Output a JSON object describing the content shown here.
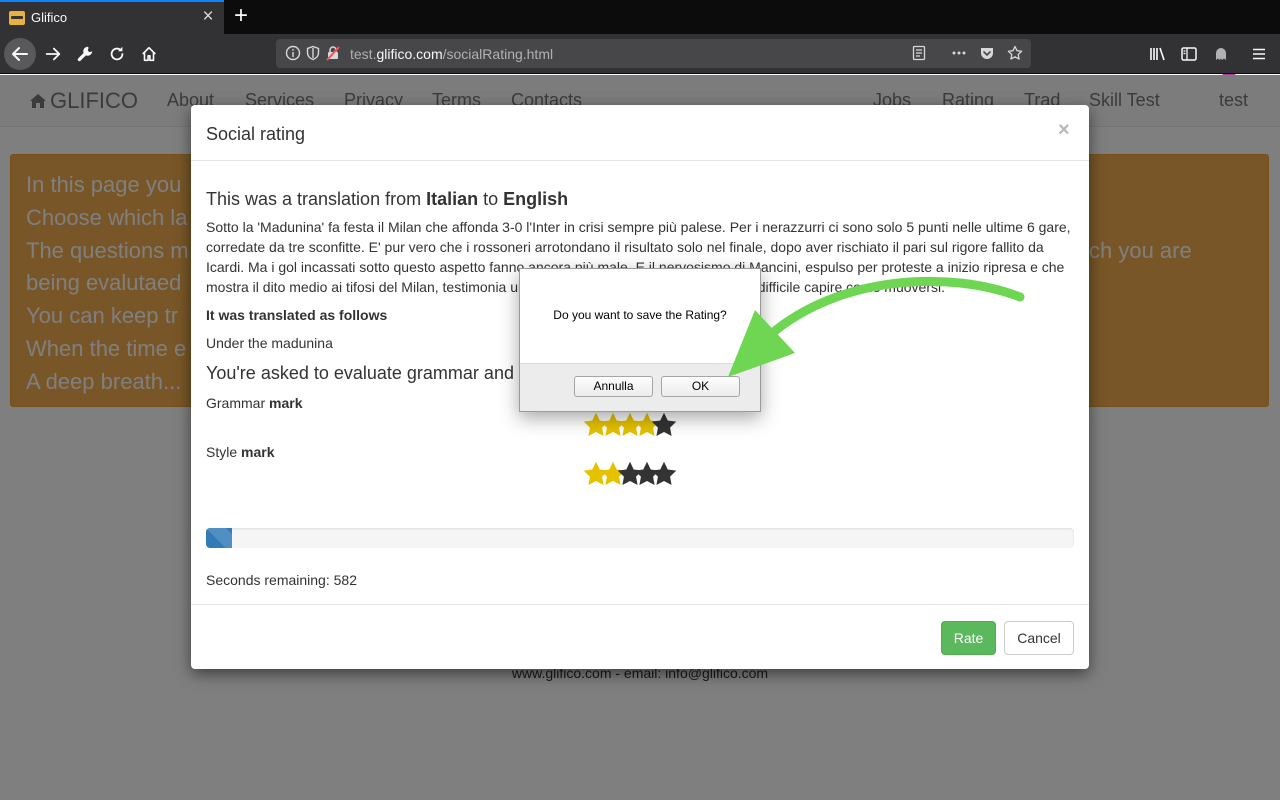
{
  "browser": {
    "tab_title": "Glifico",
    "tab_close": "×",
    "new_tab": "+",
    "url_prefix": "test.",
    "url_domain": "glifico.com",
    "url_path": "/socialRating.html",
    "notification_count": "1"
  },
  "site": {
    "brand": "GLIFICO",
    "nav_left": [
      "About",
      "Services",
      "Privacy",
      "Terms",
      "Contacts"
    ],
    "nav_right": [
      "Jobs",
      "Rating",
      "Trad",
      "Skill Test",
      "test"
    ],
    "alert_lines": [
      "In this page you",
      "Choose which la",
      "The questions m",
      "being evalutaed",
      "You can keep tr",
      "When the time e",
      "A deep breath..."
    ],
    "alert_tail": "ch you are",
    "footer": "www.glifico.com - email: info@glifico.com"
  },
  "modal": {
    "title": "Social rating",
    "close": "×",
    "heading_prefix": "This was a translation from ",
    "from_lang": "Italian",
    "heading_mid": " to ",
    "to_lang": "English",
    "source_text": "Sotto la 'Madunina' fa festa il Milan che affonda 3-0 l'Inter in crisi sempre più palese. Per i nerazzurri ci sono solo 5 punti nelle ultime 6 gare, corredate da tre sconfitte. E' pur vero che i rossoneri arrotondano il risultato solo nel finale, dopo aver rischiato il pari sul rigore fallito da Icardi. Ma i gol incassati sotto questo aspetto fanno ancora più male. E il nervosismo di Mancini, espulso per proteste a inizio ripresa e che mostra il dito medio ai tifosi del Milan, testimonia una situazione complicata sulla quale è difficile capire come muoversi.",
    "translated_label": "It was translated as follows",
    "translated_text": "Under the madunina",
    "evaluate_heading": "You're asked to evaluate grammar and style",
    "grammar_label": "Grammar",
    "style_label": "Style",
    "mark_word": "mark",
    "grammar_rating": 4,
    "style_rating": 2,
    "max_rating": 5,
    "progress_fraction": 0.03,
    "seconds_label": "Seconds remaining: 582",
    "rate_button": "Rate",
    "cancel_button": "Cancel"
  },
  "confirm_dialog": {
    "message": "Do you want to save the Rating?",
    "cancel": "Annulla",
    "ok": "OK"
  },
  "colors": {
    "star_filled": "#e5c100",
    "star_empty": "#333333",
    "arrow": "#6fd653",
    "alert": "#f0ad4e",
    "rate": "#5cb85c"
  }
}
